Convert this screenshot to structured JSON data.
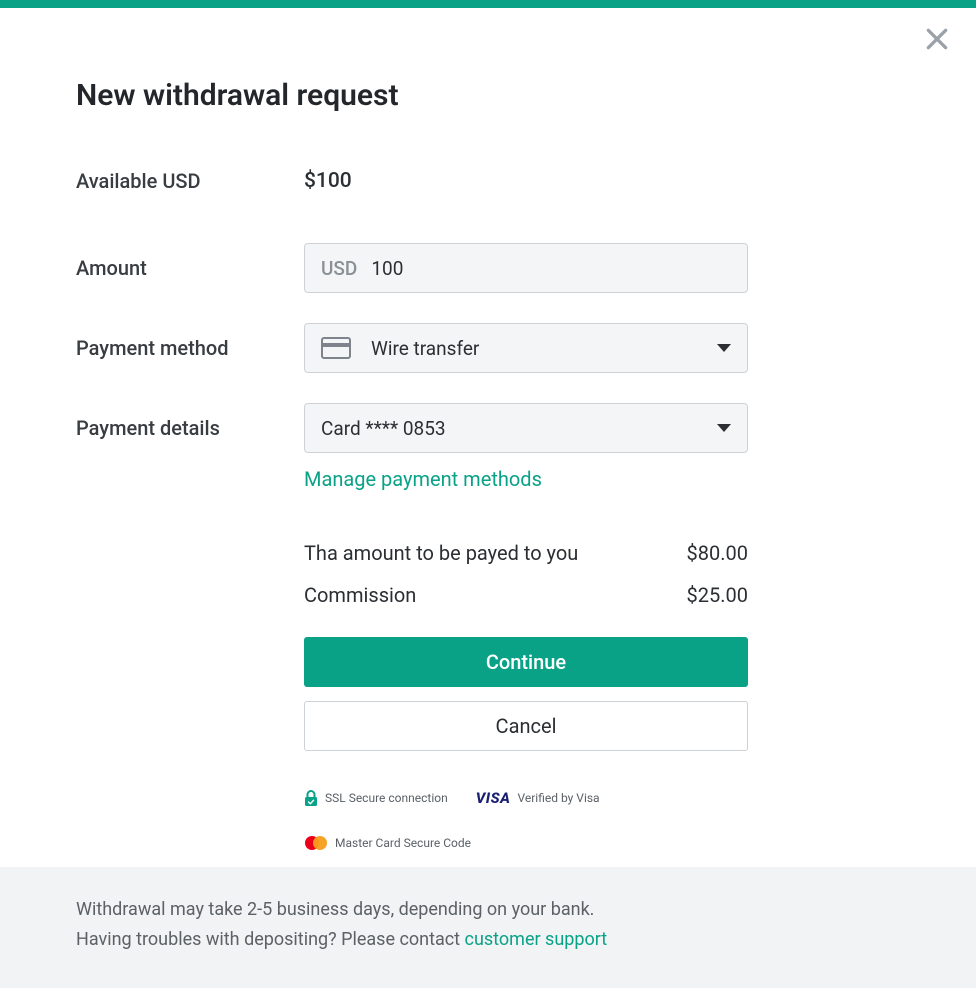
{
  "colors": {
    "accent": "#0aa287"
  },
  "header": {
    "title": "New withdrawal request"
  },
  "available": {
    "label": "Available USD",
    "value": "$100"
  },
  "amount": {
    "label": "Amount",
    "currency_prefix": "USD",
    "value": "100"
  },
  "payment_method": {
    "label": "Payment method",
    "selected": "Wire transfer"
  },
  "payment_details": {
    "label": "Payment details",
    "selected": "Card **** 0853"
  },
  "links": {
    "manage_payment_methods": "Manage payment methods"
  },
  "summary": {
    "payout_label": "Tha amount to be payed to you",
    "payout_value": "$80.00",
    "commission_label": "Commission",
    "commission_value": "$25.00"
  },
  "buttons": {
    "continue": "Continue",
    "cancel": "Cancel"
  },
  "trust": {
    "ssl_label": "SSL Secure connection",
    "visa_mark": "VISA",
    "verified_by_visa": "Verified by Visa",
    "mc_secure_code": "Master Card Secure Code"
  },
  "footer": {
    "note_delay": "Withdrawal may take 2-5 business days, depending on your bank.",
    "note_support_prefix": "Having troubles with depositing? Please contact ",
    "customer_support_link": "customer support"
  }
}
